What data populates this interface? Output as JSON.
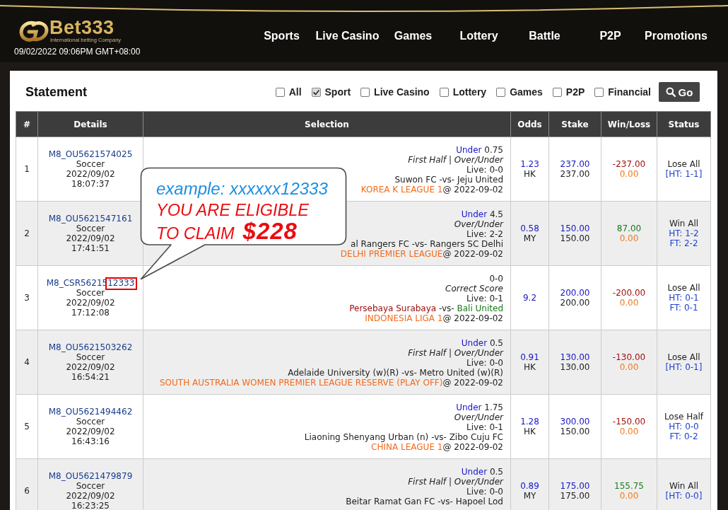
{
  "header": {
    "logo": {
      "name": "Bet333",
      "tagline": "International betting Company"
    },
    "datetime": "09/02/2022 09:06PM GMT+08:00",
    "nav": [
      "Sports",
      "Live Casino",
      "Games",
      "Lottery",
      "Battle",
      "P2P",
      "Promotions"
    ]
  },
  "statement": {
    "title": "Statement",
    "filters": [
      {
        "label": "All",
        "checked": false
      },
      {
        "label": "Sport",
        "checked": true
      },
      {
        "label": "Live Casino",
        "checked": false
      },
      {
        "label": "Lottery",
        "checked": false
      },
      {
        "label": "Games",
        "checked": false
      },
      {
        "label": "P2P",
        "checked": false
      },
      {
        "label": "Financial",
        "checked": false
      }
    ],
    "go_button": "Go"
  },
  "table": {
    "columns": [
      "#",
      "Details",
      "Selection",
      "Odds",
      "Stake",
      "Win/Loss",
      "Status"
    ],
    "rows": [
      {
        "number": "1",
        "bet_id": "M8_OU5621574025",
        "sport": "Soccer",
        "date": "2022/09/02",
        "time": "18:07:37",
        "pick": {
          "side": "Under",
          "line": "0.75"
        },
        "market": "First Half | Over/Under",
        "live": "Live: 0-0",
        "match": {
          "home": "Suwon FC",
          "vs": "-vs-",
          "away": "Jeju United",
          "highlight": false
        },
        "league": "KOREA K LEAGUE 1",
        "kickoff": "@ 2022-09-02",
        "odds": "1.23",
        "odds_type": "HK",
        "stake": "237.00",
        "actual_stake": "237.00",
        "win_loss": "-237.00",
        "won": false,
        "commission": "0.00",
        "status": "Lose All",
        "scores": [
          "[HT: 1-1]"
        ]
      },
      {
        "number": "2",
        "bet_id": "M8_OU5621547161",
        "sport": "Soccer",
        "date": "2022/09/02",
        "time": "17:41:51",
        "pick": {
          "side": "Under",
          "line": "4.5"
        },
        "market": "Over/Under",
        "live": "Live: 2-2",
        "match": {
          "home": "al Rangers FC",
          "vs": "-vs-",
          "away": "Rangers SC Delhi",
          "highlight": false
        },
        "league": "DELHI PREMIER LEAGUE",
        "kickoff": "@ 2022-09-02",
        "odds": "0.58",
        "odds_type": "MY",
        "stake": "150.00",
        "actual_stake": "150.00",
        "win_loss": "87.00",
        "won": true,
        "commission": "0.00",
        "status": "Win All",
        "scores": [
          "HT: 1-2",
          "FT: 2-2"
        ]
      },
      {
        "number": "3",
        "bet_id": "M8_CSR56215",
        "bet_id_marked": "12333",
        "sport": "Soccer",
        "date": "2022/09/02",
        "time": "17:12:08",
        "pick": {
          "line": "0-0"
        },
        "market": "Correct Score",
        "live": "Live: 0-1",
        "match": {
          "home": "Persebaya Surabaya",
          "vs": "-vs-",
          "away": "Bali United",
          "highlight": true
        },
        "league": "INDONESIA LIGA 1",
        "kickoff": "@ 2022-09-02",
        "odds": "9.2",
        "stake": "200.00",
        "actual_stake": "200.00",
        "win_loss": "-200.00",
        "won": false,
        "commission": "0.00",
        "status": "Lose All",
        "scores": [
          "HT: 0-1",
          "FT: 0-1"
        ]
      },
      {
        "number": "4",
        "bet_id": "M8_OU5621503262",
        "sport": "Soccer",
        "date": "2022/09/02",
        "time": "16:54:21",
        "pick": {
          "side": "Under",
          "line": "0.5"
        },
        "market": "First Half | Over/Under",
        "live": "Live: 0-0",
        "match": {
          "home": "Adelaide University (w)(R)",
          "vs": "-vs-",
          "away": "Metro United (w)(R)",
          "highlight": false
        },
        "league": "SOUTH AUSTRALIA WOMEN PREMIER LEAGUE RESERVE (PLAY OFF)",
        "kickoff": "@ 2022-09-02",
        "odds": "0.91",
        "odds_type": "HK",
        "stake": "130.00",
        "actual_stake": "130.00",
        "win_loss": "-130.00",
        "won": false,
        "commission": "0.00",
        "status": "Lose All",
        "scores": [
          "[HT: 0-1]"
        ]
      },
      {
        "number": "5",
        "bet_id": "M8_OU5621494462",
        "sport": "Soccer",
        "date": "2022/09/02",
        "time": "16:43:16",
        "pick": {
          "side": "Under",
          "line": "1.75"
        },
        "market": "Over/Under",
        "live": "Live: 0-1",
        "match": {
          "home": "Liaoning Shenyang Urban (n)",
          "vs": "-vs-",
          "away": "Zibo Cuju FC",
          "highlight": false
        },
        "league": "CHINA LEAGUE 1",
        "kickoff": "@ 2022-09-02",
        "odds": "1.28",
        "odds_type": "HK",
        "stake": "300.00",
        "actual_stake": "150.00",
        "win_loss": "-150.00",
        "won": false,
        "commission": "0.00",
        "status": "Lose Half",
        "scores": [
          "HT: 0-0",
          "FT: 0-2"
        ]
      },
      {
        "number": "6",
        "bet_id": "M8_OU5621479879",
        "sport": "Soccer",
        "date": "2022/09/02",
        "time": "16:23:25",
        "pick": {
          "side": "Under",
          "line": "0.5"
        },
        "market": "First Half | Over/Under",
        "live": "Live: 0-0",
        "match": {
          "home": "Beitar Ramat Gan FC",
          "vs": "-vs-",
          "away": "Hapoel Lod",
          "highlight": false
        },
        "odds": "0.89",
        "odds_type": "MY",
        "stake": "175.00",
        "actual_stake": "175.00",
        "win_loss": "155.75",
        "won": true,
        "commission": "0.00",
        "status": "Win All",
        "scores": [
          "[HT: 0-0]"
        ]
      }
    ]
  },
  "callout": {
    "example": "example: xxxxxx12333",
    "lines": [
      "YOU ARE ELIGIBLE",
      "TO CLAIM"
    ],
    "amount": "$228"
  }
}
